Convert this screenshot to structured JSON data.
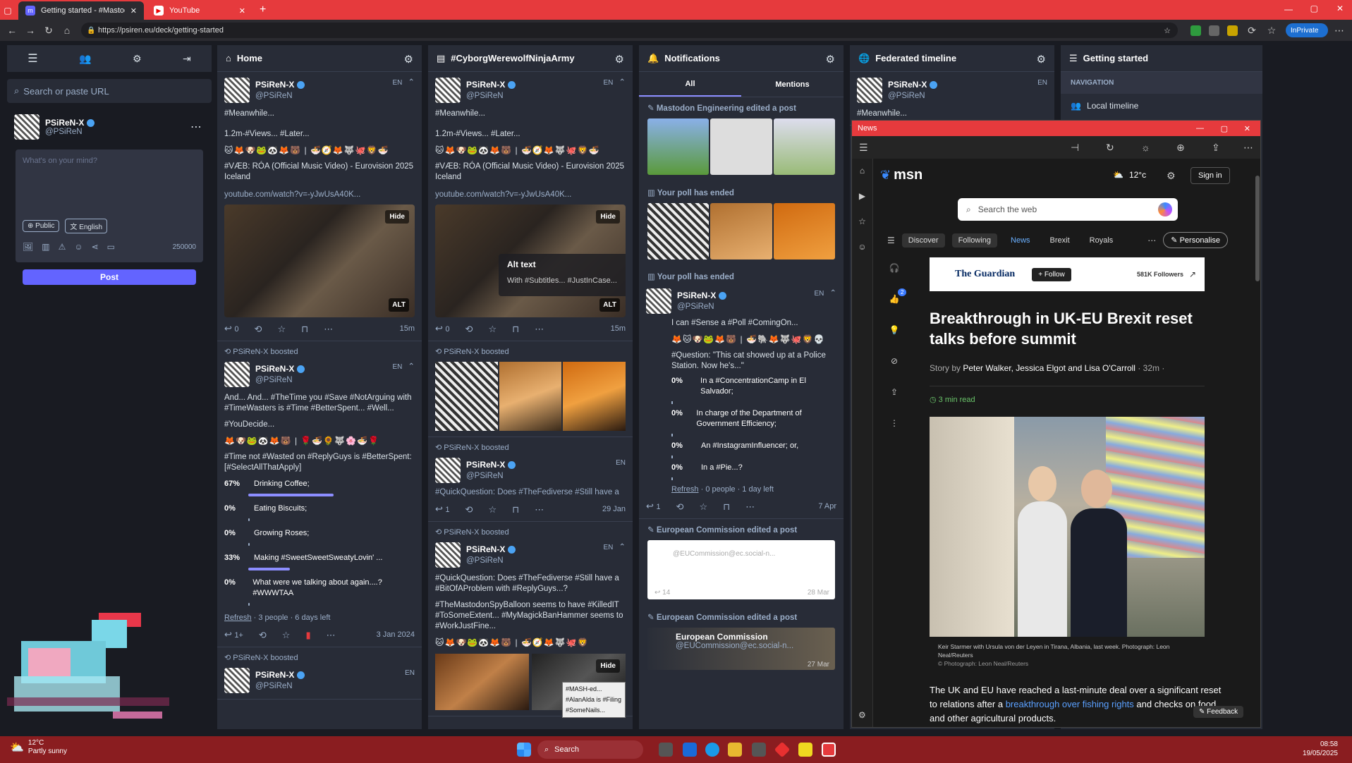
{
  "browser": {
    "tabs": [
      {
        "label": "Getting started - #MastodonSpyB...",
        "active": true
      },
      {
        "label": "YouTube",
        "active": false
      }
    ],
    "url": "https://psiren.eu/deck/getting-started",
    "inprivate": "InPrivate"
  },
  "compose": {
    "search_placeholder": "Search or paste URL",
    "user_name": "PSiReN-X",
    "user_handle": "@PSiReN",
    "placeholder": "What's on your mind?",
    "visibility": "Public",
    "language": "English",
    "char_count": "250000",
    "post_button": "Post"
  },
  "columns": {
    "home": {
      "title": "Home",
      "post1": {
        "name": "PSiReN-X",
        "handle": "@PSiReN",
        "lang": "EN",
        "line1": "#Meanwhile...",
        "line2": "1.2m-#Views... #Later...",
        "line3": "#VÆB: RÓA (Official Music Video) - Eurovision 2025 Iceland",
        "link": "youtube.com/watch?v=-yJwUsA40K...",
        "hide": "Hide",
        "alt": "ALT",
        "replies": "0",
        "time": "15m"
      },
      "boost1": "PSiReN-X boosted",
      "post2": {
        "name": "PSiReN-X",
        "handle": "@PSiReN",
        "lang": "EN",
        "line1": "And... And... #TheTime you #Save #NotArguing with #TimeWasters is #Time #BetterSpent... #Well...",
        "line2": "#YouDecide...",
        "line3": "#Time not #Wasted on #ReplyGuys is #BetterSpent: [#SelectAllThatApply]",
        "poll": [
          {
            "pct": "67%",
            "label": "Drinking Coffee;",
            "value": 0.67
          },
          {
            "pct": "0%",
            "label": "Eating Biscuits;",
            "value": 0
          },
          {
            "pct": "0%",
            "label": "Growing Roses;",
            "value": 0
          },
          {
            "pct": "33%",
            "label": "Making #SweetSweetSweatyLovin' ...",
            "value": 0.33
          },
          {
            "pct": "0%",
            "label": "What were we talking about again....? #WWWTAA",
            "value": 0
          }
        ],
        "refresh": "Refresh",
        "meta": "· 3 people · 6 days left",
        "replies": "1+",
        "time": "3 Jan 2024"
      },
      "boost2": "PSiReN-X boosted",
      "post3": {
        "name": "PSiReN-X",
        "handle": "@PSiReN",
        "lang": "EN"
      }
    },
    "tag": {
      "title": "#CyborgWerewolfNinjaArmy",
      "post1": {
        "name": "PSiReN-X",
        "handle": "@PSiReN",
        "lang": "EN",
        "line1": "#Meanwhile...",
        "line2": "1.2m-#Views... #Later...",
        "line3": "#VÆB: RÓA (Official Music Video) - Eurovision 2025 Iceland",
        "link": "youtube.com/watch?v=-yJwUsA40K...",
        "hide": "Hide",
        "alt_title": "Alt text",
        "alt_body": "With #Subtitles... #JustInCase...",
        "alt": "ALT",
        "replies": "0",
        "time": "15m"
      },
      "boost1": "PSiReN-X boosted",
      "boost2": "PSiReN-X boosted",
      "post2": {
        "name": "PSiReN-X",
        "handle": "@PSiReN",
        "lang": "EN",
        "line1": "#QuickQuestion: Does #TheFediverse #Still have a",
        "replies": "1",
        "time": "29 Jan"
      },
      "boost3": "PSiReN-X boosted",
      "post3": {
        "name": "PSiReN-X",
        "handle": "@PSiReN",
        "lang": "EN",
        "line1": "#QuickQuestion: Does #TheFediverse #Still have a #BitOfAProblem with #ReplyGuys...?",
        "line2": "#TheMastodonSpyBalloon seems to have #KilledIT #ToSomeExtent... #MyMagickBanHammer seems to #WorkJustFine...",
        "hide": "Hide",
        "tooltip": "#MASH-ed... #AlanAlda is #Filing #SomeNails..."
      }
    },
    "notifications": {
      "title": "Notifications",
      "tab_all": "All",
      "tab_mentions": "Mentions",
      "n1": "Mastodon Engineering edited a post",
      "n2": "Your poll has ended",
      "n3": "Your poll has ended",
      "post": {
        "name": "PSiReN-X",
        "handle": "@PSiReN",
        "lang": "EN",
        "line1": "I can #Sense a #Poll #ComingOn...",
        "line2": "#Question: \"This cat showed up at a Police Station. Now he's...\"",
        "poll": [
          {
            "pct": "0%",
            "label": "In a #ConcentrationCamp in El Salvador;"
          },
          {
            "pct": "0%",
            "label": "In charge of the Department of Government Efficiency;"
          },
          {
            "pct": "0%",
            "label": "An #InstagramInfluencer; or,"
          },
          {
            "pct": "0%",
            "label": "In a #Pie...?"
          }
        ],
        "refresh": "Refresh",
        "meta": "· 0 people · 1 day left",
        "replies": "1",
        "time": "7 Apr"
      },
      "n4": "European Commission edited a post",
      "n4_handle": "@EUCommission@ec.social-n...",
      "n4_replies": "14",
      "n4_time": "28 Mar",
      "n5": "European Commission edited a post",
      "n5_name": "European Commission",
      "n5_handle": "@EUCommission@ec.social-n...",
      "n5_time": "27 Mar"
    },
    "federated": {
      "title": "Federated timeline",
      "post1": {
        "name": "PSiReN-X",
        "handle": "@PSiReN",
        "lang": "EN",
        "line1": "#Meanwhile..."
      }
    },
    "getting_started": {
      "title": "Getting started",
      "nav_header": "NAVIGATION",
      "local_timeline": "Local timeline"
    }
  },
  "msn": {
    "window_title": "News",
    "logo": "msn",
    "weather": "12°c",
    "sign_in": "Sign in",
    "search_placeholder": "Search the web",
    "nav": [
      "Discover",
      "Following",
      "News",
      "Brexit",
      "Royals"
    ],
    "personalise": "Personalise",
    "publisher": "The Guardian",
    "follow": "+ Follow",
    "followers": "581K Followers",
    "headline": "Breakthrough in UK-EU Brexit reset talks before summit",
    "story_by": "Story by",
    "authors": "Peter Walker, Jessica Elgot and Lisa O'Carroll",
    "age": "· 32m ·",
    "read_time": "3 min read",
    "caption": "Keir Starmer with Ursula von der Leyen in Tirana, Albania, last week. Photograph: Leon Neal/Reuters",
    "credit": "© Photograph: Leon Neal/Reuters",
    "body_start": "The UK and EU have reached a last-minute deal over a significant reset to relations after a",
    "body_link": "breakthrough over fishing rights",
    "body_end": "and checks on food and other agricultural products.",
    "feedback": "Feedback",
    "badge": "2"
  },
  "taskbar": {
    "weather_temp": "12°C",
    "weather_desc": "Partly sunny",
    "search": "Search",
    "time": "08:58",
    "date": "19/05/2025"
  },
  "colors": {
    "accent": "#e63a3d",
    "mastodon_button": "#6364ff",
    "deck_bg": "#191b22",
    "column_bg": "#282c37"
  }
}
